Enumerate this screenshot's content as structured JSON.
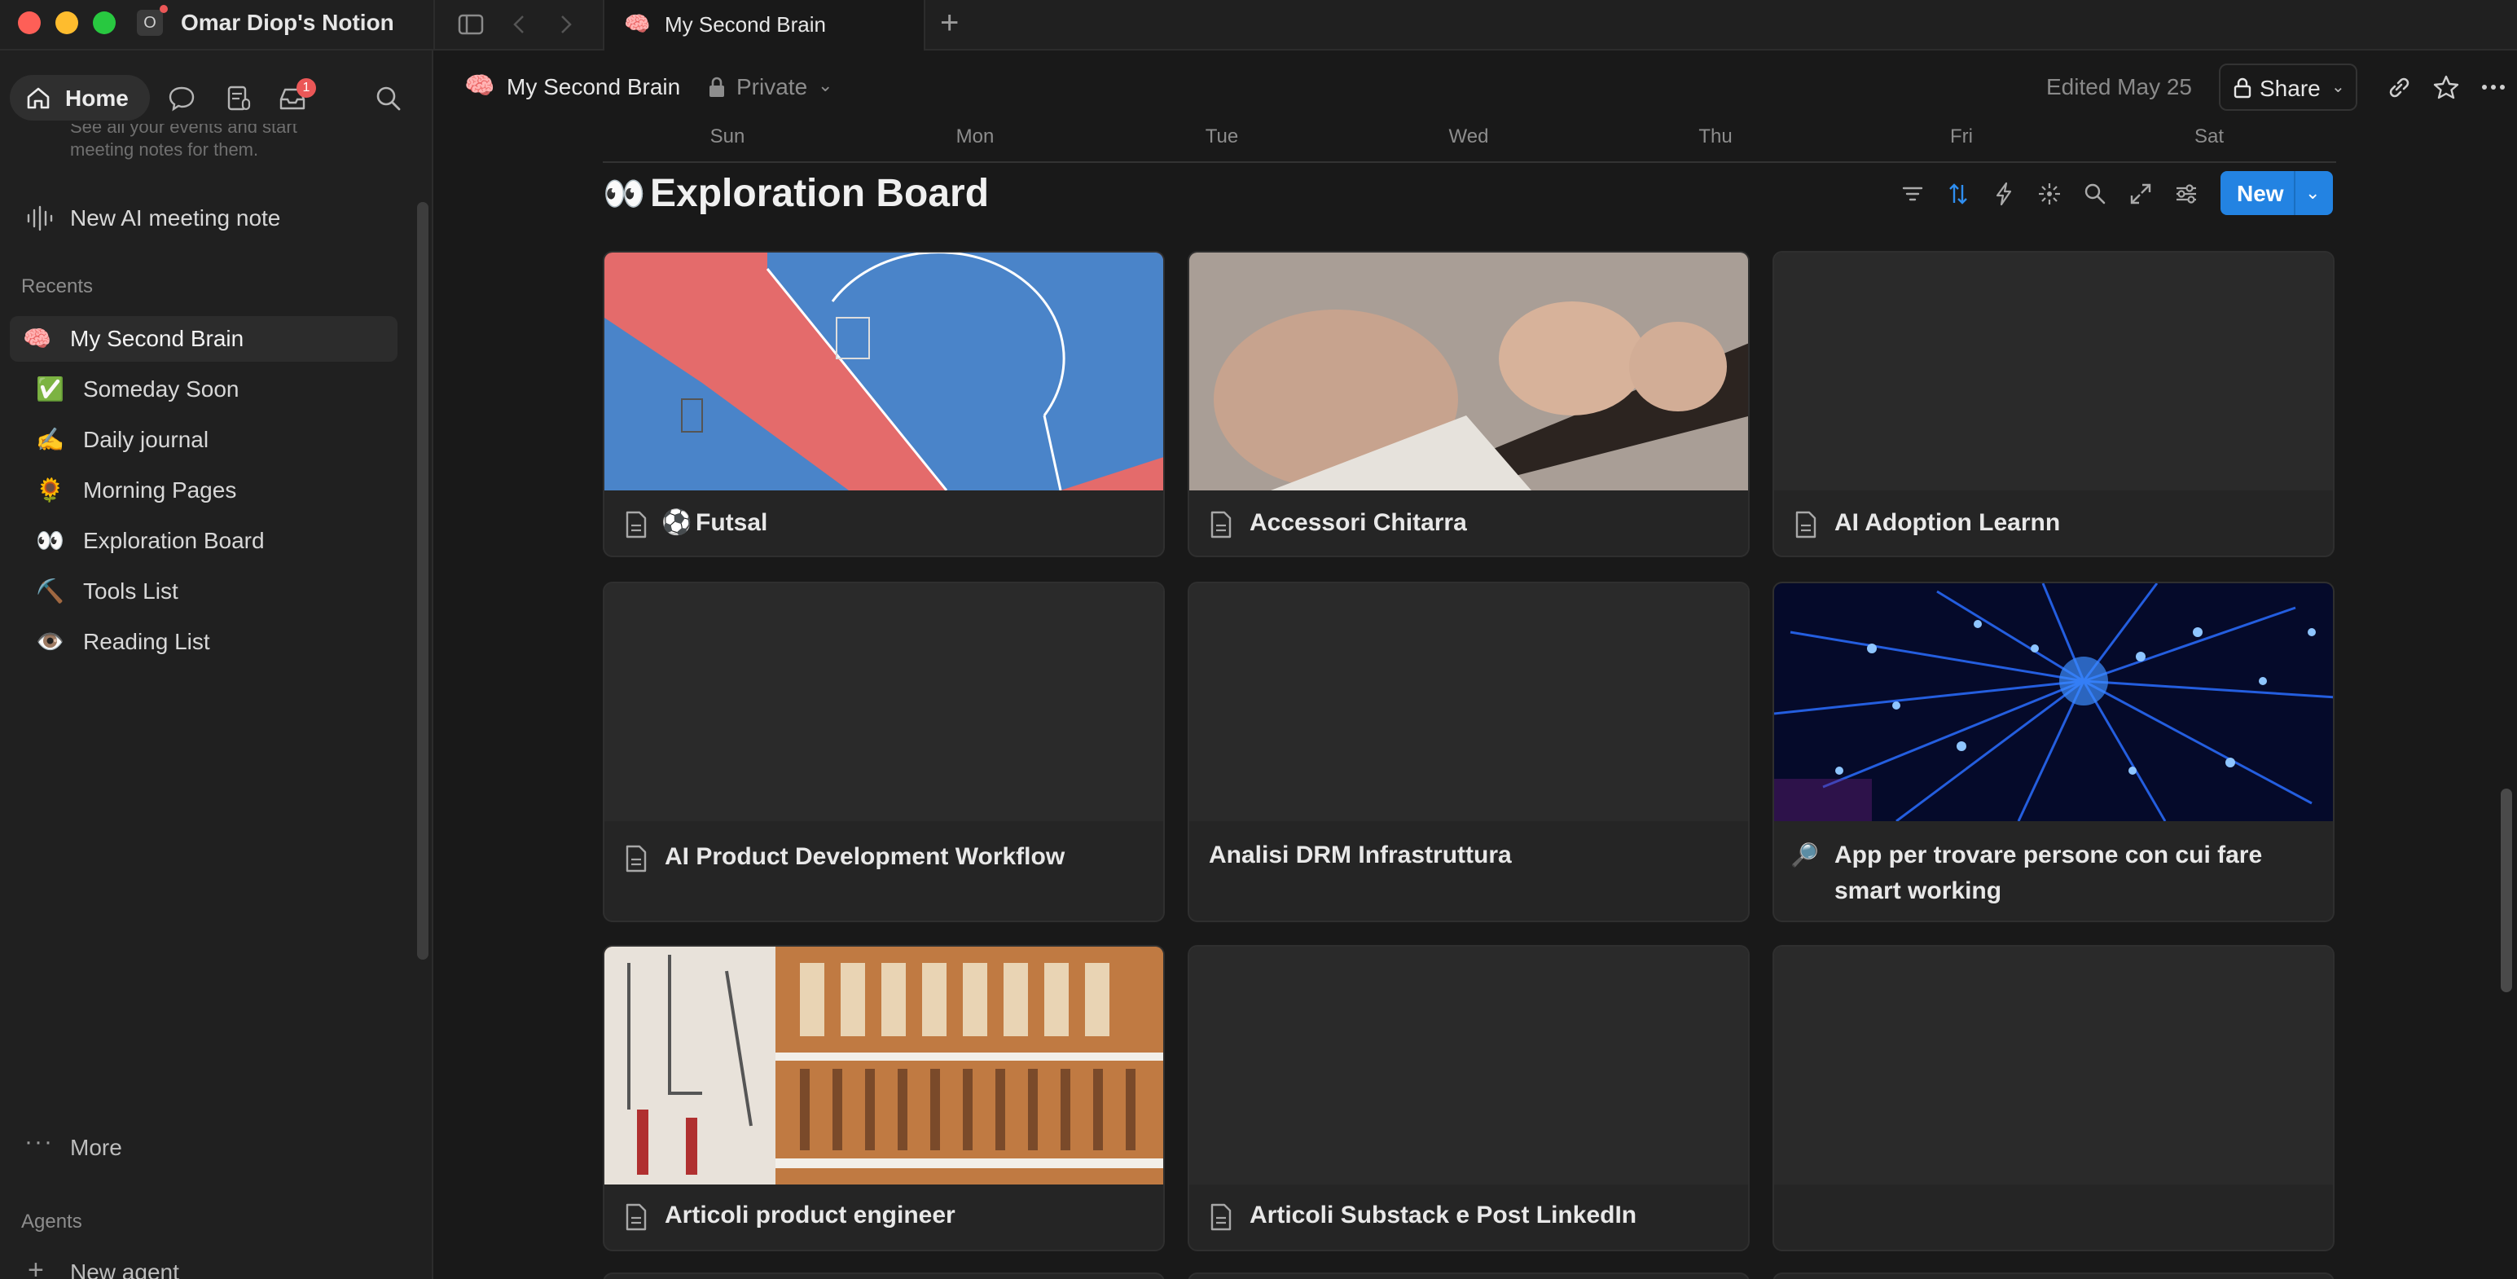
{
  "window": {
    "workspace_initial": "O",
    "workspace_name": "Omar Diop's Notion",
    "tab": {
      "emoji": "🧠",
      "label": "My Second Brain"
    },
    "new_tab_glyph": "+"
  },
  "sidebar": {
    "home_label": "Home",
    "inbox_badge": "1",
    "faded_text_line1": "See all your events and start",
    "faded_text_line2": "meeting notes for them.",
    "new_meeting_label": "New AI meeting note",
    "recents_header": "Recents",
    "recents": [
      {
        "emoji": "🧠",
        "label": "My Second Brain",
        "active": true
      },
      {
        "emoji": "✅",
        "label": "Someday Soon"
      },
      {
        "emoji": "✍️",
        "label": "Daily journal"
      },
      {
        "emoji": "🌻",
        "label": "Morning Pages"
      },
      {
        "emoji": "👀",
        "label": "Exploration Board"
      },
      {
        "emoji": "⛏️",
        "label": "Tools List"
      },
      {
        "emoji": "👁️",
        "label": "Reading List"
      }
    ],
    "more_label": "More",
    "agents_header": "Agents",
    "new_agent_label": "New agent"
  },
  "header": {
    "page_emoji": "🧠",
    "page_title": "My Second Brain",
    "privacy": "Private",
    "edited": "Edited May 25",
    "share_label": "Share"
  },
  "calendar_days": [
    "Sun",
    "Mon",
    "Tue",
    "Wed",
    "Thu",
    "Fri",
    "Sat"
  ],
  "board": {
    "emoji": "👀",
    "title": "Exploration Board",
    "new_label": "New",
    "cards": [
      {
        "title": "Futsal",
        "title_emoji": "⚽",
        "icon": "document-icon",
        "cover": "futsal-court"
      },
      {
        "title": "Accessori Chitarra",
        "icon": "document-icon",
        "cover": "guitar"
      },
      {
        "title": "AI Adoption Learnn",
        "icon": "document-icon",
        "cover": "none"
      },
      {
        "title": "AI Product Development Workflow",
        "icon": "document-icon",
        "cover": "none"
      },
      {
        "title": "Analisi DRM Infrastruttura",
        "icon": "none",
        "cover": "none"
      },
      {
        "title": "App per trovare persone con cui fare",
        "title_line2": "smart working",
        "icon": "magnifier-emoji",
        "cover": "blue-network"
      },
      {
        "title": "Articoli product engineer",
        "icon": "document-icon",
        "cover": "tools-wall"
      },
      {
        "title": "Articoli Substack e Post LinkedIn",
        "icon": "document-icon",
        "cover": "none"
      },
      {
        "title": "",
        "icon": "none",
        "cover": "none"
      }
    ]
  },
  "colors": {
    "background": "#191919",
    "sidebar": "#202020",
    "card": "#252525",
    "accent_blue": "#2383e2",
    "badge_red": "#eb5757"
  }
}
